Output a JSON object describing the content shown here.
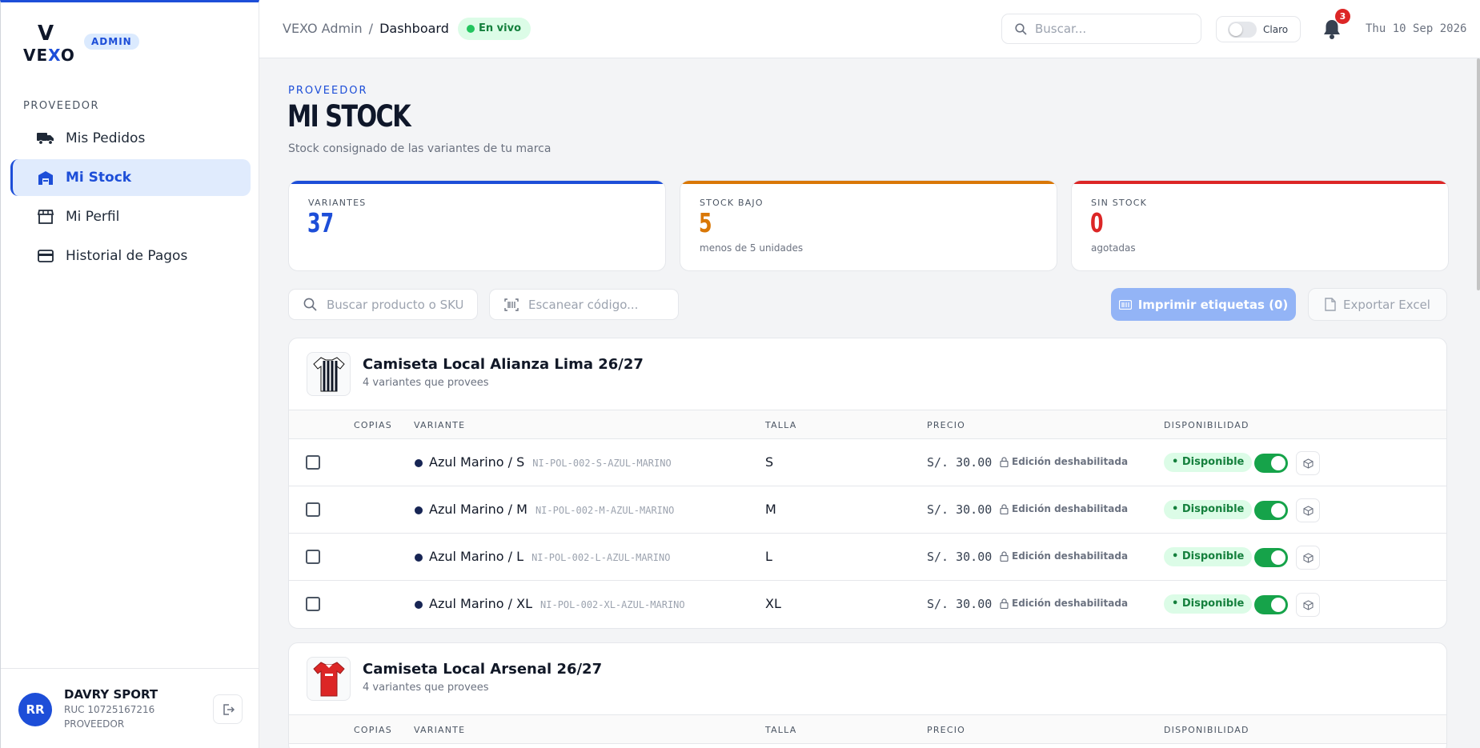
{
  "brand": {
    "logo_v": "V",
    "logo_pre": "VE",
    "logo_x": "X",
    "logo_post": "O",
    "badge": "ADMIN"
  },
  "sidebar": {
    "section": "PROVEEDOR",
    "items": [
      {
        "label": "Mis Pedidos",
        "icon": "truck-icon"
      },
      {
        "label": "Mi Stock",
        "icon": "warehouse-icon",
        "active": true
      },
      {
        "label": "Mi Perfil",
        "icon": "store-icon"
      },
      {
        "label": "Historial de Pagos",
        "icon": "credit-card-icon"
      }
    ],
    "user": {
      "initials": "RR",
      "name": "DAVRY SPORT",
      "ruc": "RUC 10725167216",
      "role": "PROVEEDOR"
    }
  },
  "header": {
    "crumb_root": "VEXO Admin",
    "crumb_sep": "/",
    "crumb_current": "Dashboard",
    "live": "En vivo",
    "search_placeholder": "Buscar...",
    "theme_label": "Claro",
    "notifications": "3",
    "date": "Thu 10 Sep 2026"
  },
  "page": {
    "kicker": "PROVEEDOR",
    "title": "MI STOCK",
    "subtitle": "Stock consignado de las variantes de tu marca"
  },
  "stats": [
    {
      "label": "VARIANTES",
      "value": "37",
      "hint": "",
      "color": "#1d4ed8"
    },
    {
      "label": "STOCK BAJO",
      "value": "5",
      "hint": "menos de 5 unidades",
      "color": "#d97706"
    },
    {
      "label": "SIN STOCK",
      "value": "0",
      "hint": "agotadas",
      "color": "#dc2626"
    }
  ],
  "toolbar": {
    "search_placeholder": "Buscar producto o SKU...",
    "scan_placeholder": "Escanear código...",
    "print_label": "Imprimir etiquetas (0)",
    "export_label": "Exportar Excel"
  },
  "table_headers": {
    "copias": "COPIAS",
    "variante": "VARIANTE",
    "talla": "TALLA",
    "precio": "PRECIO",
    "disponibilidad": "DISPONIBILIDAD"
  },
  "products": [
    {
      "name": "Camiseta Local Alianza Lima 26/27",
      "sub": "4 variantes que provees",
      "rows": [
        {
          "variant": "Azul Marino / S",
          "sku": "NI-POL-002-S-AZUL-MARINO",
          "size": "S",
          "price": "S/. 30.00",
          "lock": "Edición deshabilitada",
          "status": "Disponible"
        },
        {
          "variant": "Azul Marino / M",
          "sku": "NI-POL-002-M-AZUL-MARINO",
          "size": "M",
          "price": "S/. 30.00",
          "lock": "Edición deshabilitada",
          "status": "Disponible"
        },
        {
          "variant": "Azul Marino / L",
          "sku": "NI-POL-002-L-AZUL-MARINO",
          "size": "L",
          "price": "S/. 30.00",
          "lock": "Edición deshabilitada",
          "status": "Disponible"
        },
        {
          "variant": "Azul Marino / XL",
          "sku": "NI-POL-002-XL-AZUL-MARINO",
          "size": "XL",
          "price": "S/. 30.00",
          "lock": "Edición deshabilitada",
          "status": "Disponible"
        }
      ]
    },
    {
      "name": "Camiseta Local Arsenal 26/27",
      "sub": "4 variantes que provees",
      "rows": []
    }
  ]
}
